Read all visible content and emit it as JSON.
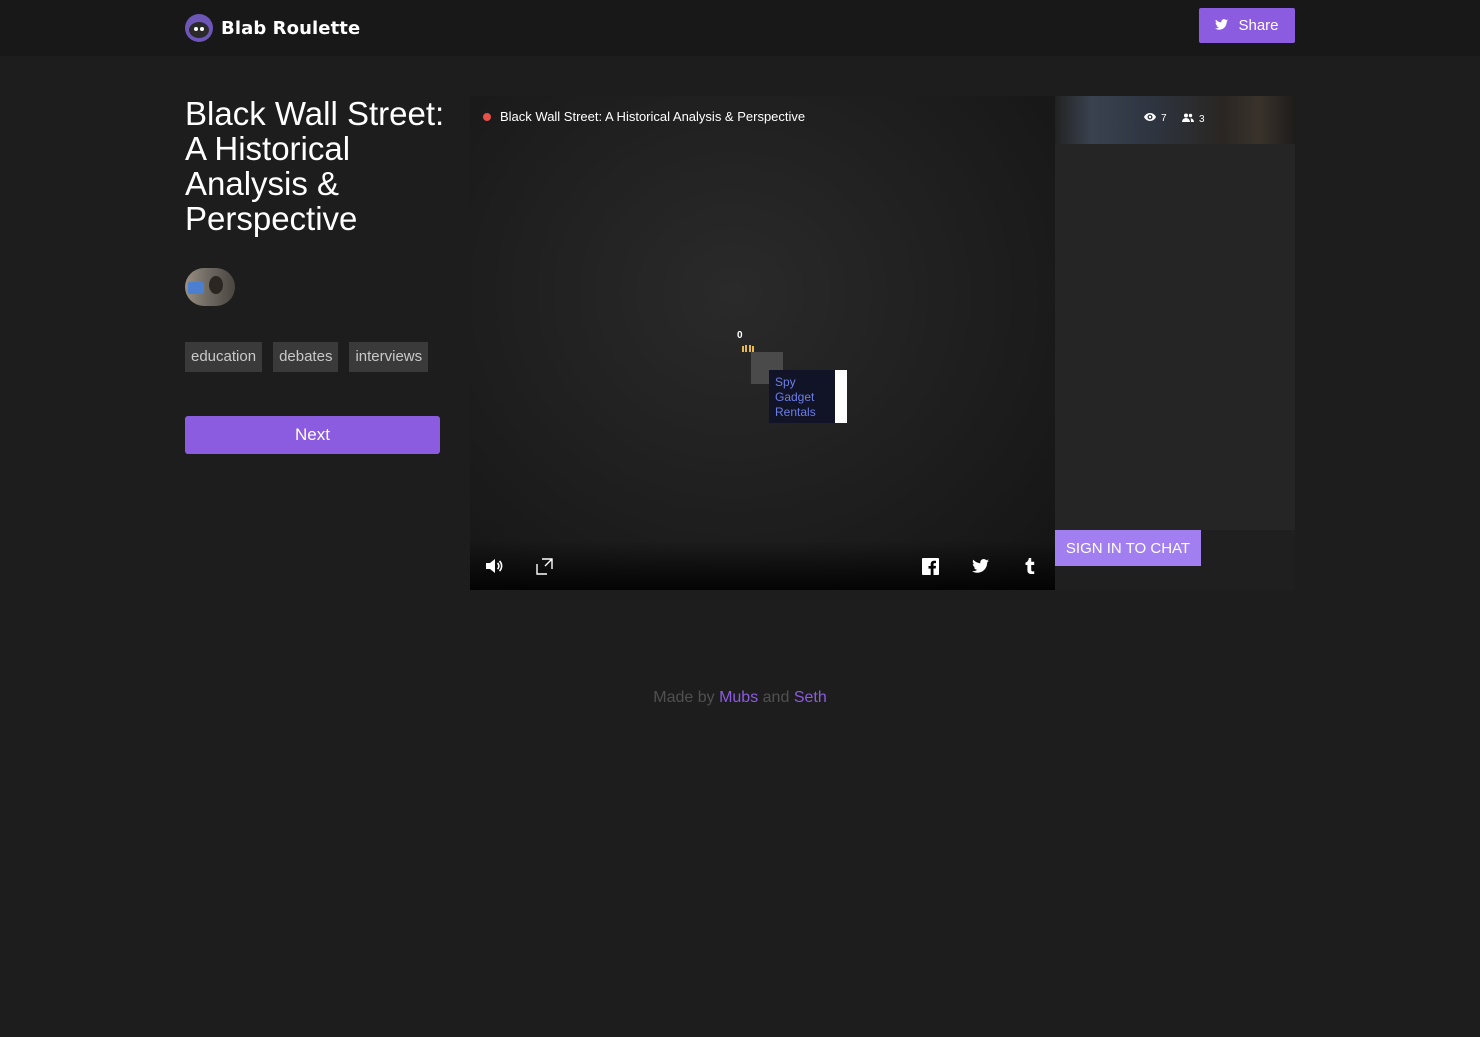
{
  "app": {
    "name": "Blab Roulette",
    "share_label": "Share"
  },
  "blab": {
    "title": "Black Wall Street: A Historical Analysis & Perspective",
    "tags": [
      "education",
      "debates",
      "interviews"
    ],
    "next_label": "Next"
  },
  "player": {
    "title": "Black Wall Street: A Historical Analysis & Perspective",
    "reaction_count": "0",
    "ad_text": "Spy Gadget Rentals",
    "viewers": "7",
    "listeners": "3"
  },
  "chat": {
    "signin_label": "SIGN IN TO CHAT"
  },
  "footer": {
    "made_by": "Made by",
    "and": "and",
    "author1": "Mubs",
    "author2": "Seth"
  },
  "colors": {
    "accent": "#8b5ce0",
    "signin": "#a27ff0",
    "live": "#e8504a",
    "background": "#1d1d1d"
  },
  "icons": [
    "owl-logo-icon",
    "twitter-icon",
    "volume-icon",
    "fullscreen-icon",
    "facebook-icon",
    "tumblr-icon",
    "eye-icon",
    "users-icon",
    "raised-hands-icon"
  ]
}
